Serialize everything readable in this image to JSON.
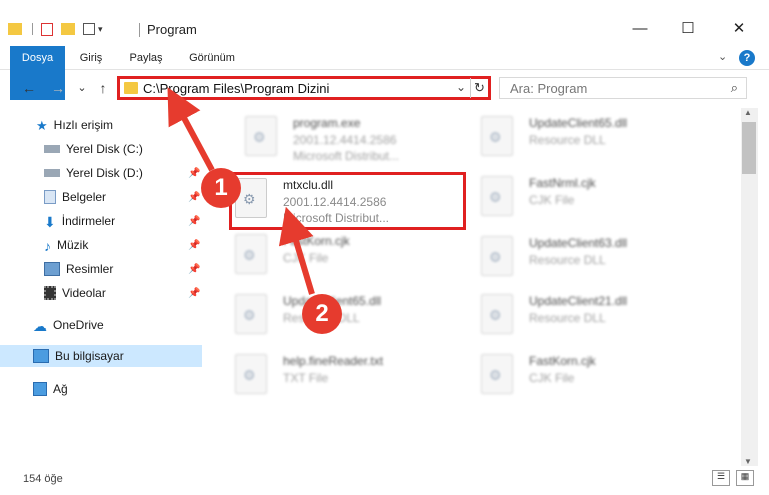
{
  "window": {
    "title": "Program",
    "minimize": "—",
    "maximize": "☐",
    "close": "✕"
  },
  "ribbon": {
    "tabs": [
      "Dosya",
      "Giriş",
      "Paylaş",
      "Görünüm"
    ],
    "help": "?"
  },
  "nav": {
    "back": "←",
    "forward": "→",
    "recent": "⌄",
    "up": "↑",
    "address": "C:\\Program Files\\Program Dizini",
    "search_placeholder": "Ara: Program"
  },
  "sidebar": {
    "quick_access": "Hızlı erişim",
    "items": [
      {
        "label": "Yerel Disk (C:)",
        "icon": "drive-icon",
        "pinned": true
      },
      {
        "label": "Yerel Disk (D:)",
        "icon": "drive-icon",
        "pinned": true
      },
      {
        "label": "Belgeler",
        "icon": "documents-icon",
        "pinned": true
      },
      {
        "label": "İndirmeler",
        "icon": "downloads-icon",
        "pinned": true
      },
      {
        "label": "Müzik",
        "icon": "music-icon",
        "pinned": true
      },
      {
        "label": "Resimler",
        "icon": "pictures-icon",
        "pinned": true
      },
      {
        "label": "Videolar",
        "icon": "videos-icon",
        "pinned": true
      }
    ],
    "onedrive": "OneDrive",
    "this_pc": "Bu bilgisayar",
    "network": "Ağ"
  },
  "files": {
    "left": [
      {
        "name": "program.exe",
        "line2": "2001.12.4414.2586",
        "line3": "Microsoft Distribut..."
      },
      {
        "name": "mtxclu.dll",
        "line2": "2001.12.4414.2586",
        "line3": "Microsoft Distribut..."
      },
      {
        "name": "FastKorn.cjk",
        "line2": "CJK File",
        "line3": ""
      },
      {
        "name": "UpdateClient65.dll",
        "line2": "Resource DLL",
        "line3": ""
      },
      {
        "name": "help.fineReader.txt",
        "line2": "TXT File",
        "line3": ""
      }
    ],
    "right": [
      {
        "name": "UpdateClient65.dll",
        "line2": "Resource DLL"
      },
      {
        "name": "FastNrml.cjk",
        "line2": "CJK File"
      },
      {
        "name": "UpdateClient63.dll",
        "line2": "Resource DLL"
      },
      {
        "name": "UpdateClient21.dll",
        "line2": "Resource DLL"
      },
      {
        "name": "FastKorn.cjk",
        "line2": "CJK File"
      }
    ]
  },
  "status": {
    "count": "154 öğe"
  },
  "annotations": {
    "step1": "1",
    "step2": "2",
    "color": "#e63b2e"
  }
}
